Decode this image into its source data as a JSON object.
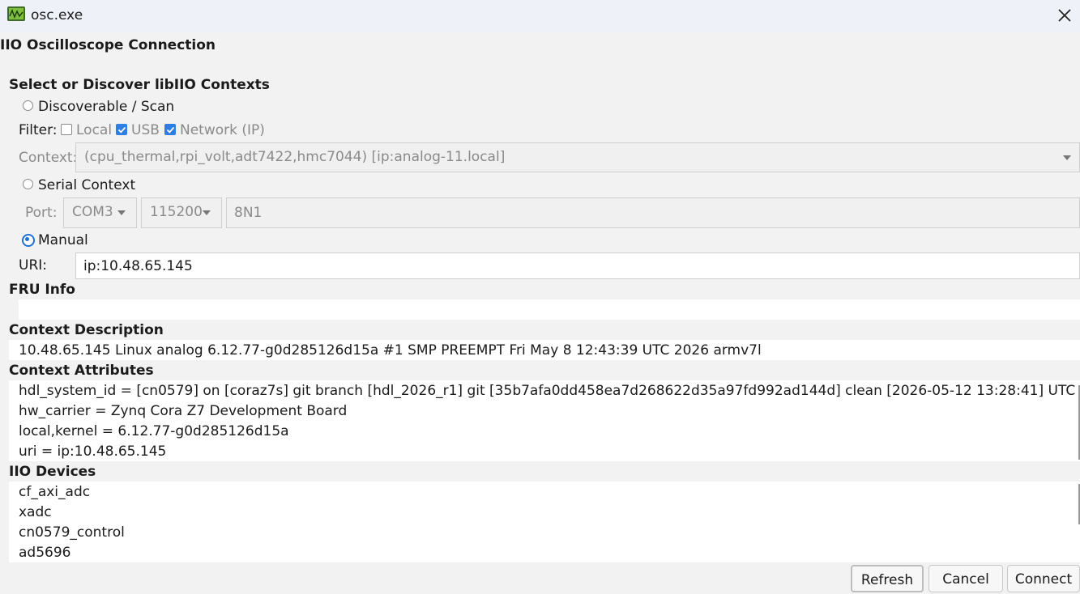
{
  "window": {
    "title": "osc.exe",
    "close_icon": "close-icon",
    "app_icon": "oscilloscope-app-icon"
  },
  "dialog_title": "IIO Oscilloscope Connection",
  "section_select": "Select or Discover libIIO Contexts",
  "discover": {
    "radio_label": "Discoverable / Scan",
    "filter_label": "Filter:",
    "filters": [
      {
        "label": "Local",
        "checked": false
      },
      {
        "label": "USB",
        "checked": true
      },
      {
        "label": "Network (IP)",
        "checked": true
      }
    ],
    "context_label": "Context:",
    "context_value": "(cpu_thermal,rpi_volt,adt7422,hmc7044) [ip:analog-11.local]"
  },
  "serial": {
    "radio_label": "Serial Context",
    "port_label": "Port:",
    "port_value": "COM3",
    "baud_value": "115200",
    "config_value": "8N1"
  },
  "manual": {
    "radio_label": "Manual",
    "uri_label": "URI:",
    "uri_value": "ip:10.48.65.145"
  },
  "fru": {
    "heading": "FRU Info"
  },
  "context_description": {
    "heading": "Context Description",
    "text": "10.48.65.145 Linux analog 6.12.77-g0d285126d15a #1 SMP PREEMPT Fri May  8 12:43:39 UTC 2026 armv7l"
  },
  "context_attributes": {
    "heading": "Context Attributes",
    "items": [
      "hdl_system_id = [cn0579] on [coraz7s] git branch [hdl_2026_r1] git [35b7afa0dd458ea7d268622d35a97fd992ad144d] clean [2026-05-12 13:28:41] UTC",
      "hw_carrier = Zynq Cora Z7 Development Board",
      "local,kernel = 6.12.77-g0d285126d15a",
      "uri = ip:10.48.65.145"
    ]
  },
  "iio_devices": {
    "heading": "IIO Devices",
    "items": [
      "cf_axi_adc",
      "xadc",
      "cn0579_control",
      "ad5696"
    ]
  },
  "buttons": {
    "refresh": "Refresh",
    "cancel": "Cancel",
    "connect": "Connect"
  },
  "colors": {
    "accent": "#1e6fd9",
    "checkbox_fill": "#2d7fe3",
    "titlebar_bg": "#eef2f8",
    "window_bg": "#f2f2f2"
  }
}
